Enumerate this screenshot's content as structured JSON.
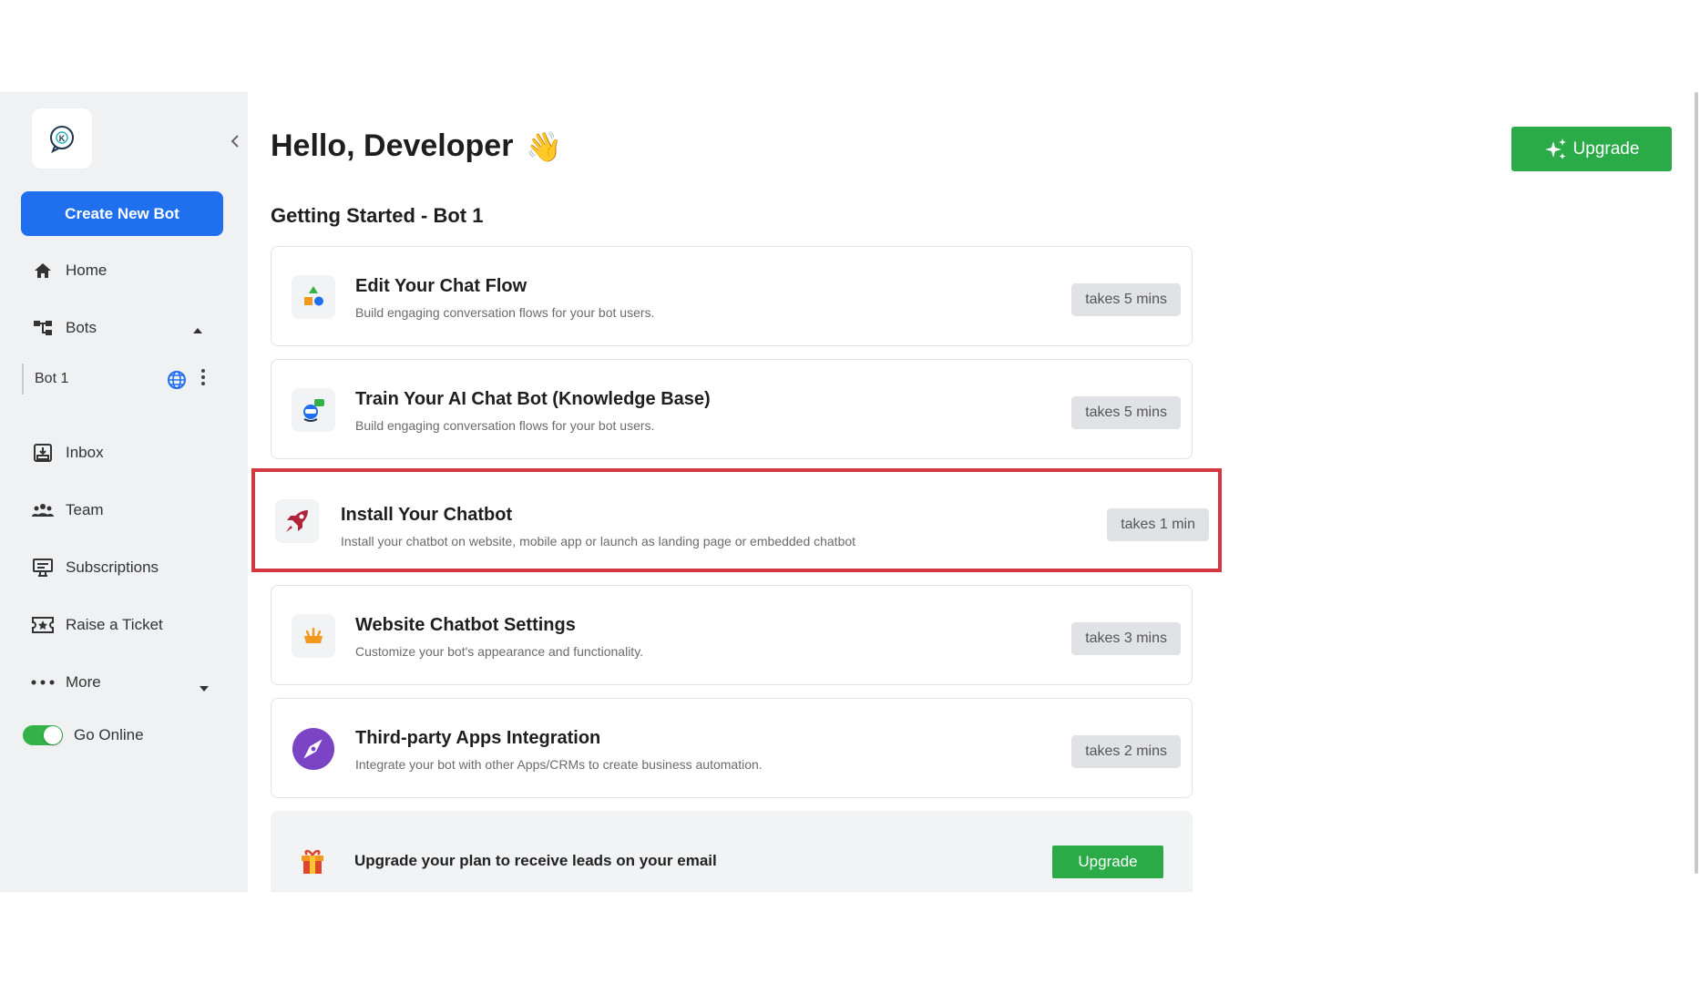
{
  "sidebar": {
    "create_label": "Create New Bot",
    "items": {
      "home": "Home",
      "bots": "Bots",
      "bot1": "Bot 1",
      "inbox": "Inbox",
      "team": "Team",
      "subscriptions": "Subscriptions",
      "ticket": "Raise a Ticket",
      "more": "More"
    },
    "go_online": "Go Online"
  },
  "header": {
    "greeting": "Hello, Developer",
    "wave": "👋",
    "upgrade": "Upgrade"
  },
  "section_title": "Getting Started - Bot 1",
  "tasks": [
    {
      "title": "Edit Your Chat Flow",
      "desc": "Build engaging conversation flows for your bot users.",
      "time": "takes 5 mins"
    },
    {
      "title": "Train Your AI Chat Bot (Knowledge Base)",
      "desc": "Build engaging conversation flows for your bot users.",
      "time": "takes 5 mins"
    },
    {
      "title": "Install Your Chatbot",
      "desc": "Install your chatbot on website, mobile app or launch as landing page or embedded chatbot",
      "time": "takes 1 min"
    },
    {
      "title": "Website Chatbot Settings",
      "desc": "Customize your bot's appearance and functionality.",
      "time": "takes 3 mins"
    },
    {
      "title": "Third-party Apps Integration",
      "desc": "Integrate your bot with other Apps/CRMs to create business automation.",
      "time": "takes 2 mins"
    }
  ],
  "promo": {
    "text": "Upgrade your plan to receive leads on your email",
    "button": "Upgrade"
  },
  "colors": {
    "primary_blue": "#1f6fee",
    "upgrade_green": "#2bab47",
    "highlight_red": "#d4373f",
    "sidebar_bg": "#f0f1f3"
  }
}
